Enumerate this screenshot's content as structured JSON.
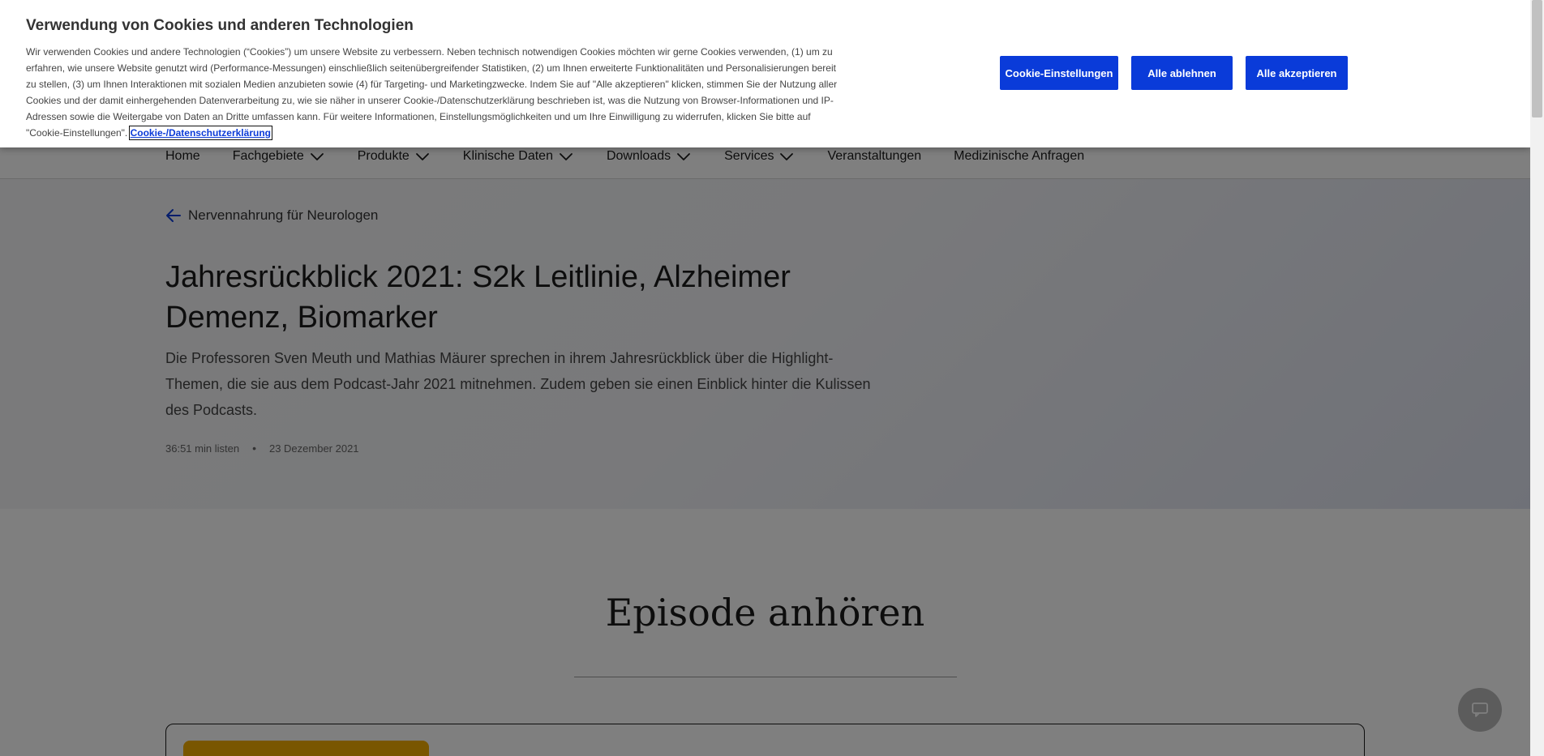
{
  "nav": {
    "items": [
      {
        "label": "Home",
        "has_dropdown": false
      },
      {
        "label": "Fachgebiete",
        "has_dropdown": true
      },
      {
        "label": "Produkte",
        "has_dropdown": true
      },
      {
        "label": "Klinische Daten",
        "has_dropdown": true
      },
      {
        "label": "Downloads",
        "has_dropdown": true
      },
      {
        "label": "Services",
        "has_dropdown": true
      },
      {
        "label": "Veranstaltungen",
        "has_dropdown": false
      },
      {
        "label": "Medizinische Anfragen",
        "has_dropdown": false
      }
    ]
  },
  "hero": {
    "back_label": "Nervennahrung für Neurologen",
    "title": "Jahresrückblick 2021: S2k Leitlinie, Alzheimer Demenz, Biomarker",
    "description": "Die Professoren Sven Meuth und Mathias Mäurer sprechen in ihrem Jahresrückblick über die Highlight-Themen, die sie aus dem Podcast-Jahr 2021 mitnehmen. Zudem geben sie einen Einblick hinter die Kulissen des Podcasts.",
    "duration": "36:51 min listen",
    "separator": "•",
    "date": "23 Dezember 2021"
  },
  "episode": {
    "heading": "Episode anhören"
  },
  "cookie_banner": {
    "title": "Verwendung von Cookies und anderen Technologien",
    "text": "Wir verwenden Cookies und andere Technologien (“Cookies”) um unsere Website zu verbessern. Neben technisch notwendigen Cookies möchten wir gerne Cookies verwenden, (1) um zu erfahren, wie unsere Website genutzt wird (Performance-Messungen) einschließlich seitenübergreifender Statistiken, (2) um Ihnen erweiterte Funktionalitäten und Personalisierungen bereit zu stellen, (3) um Ihnen Interaktionen mit sozialen Medien anzubieten sowie (4) für Targeting- und Marketingzwecke. Indem Sie auf \"Alle akzeptieren\" klicken, stimmen Sie der Nutzung aller Cookies und der damit einhergehenden Datenverarbeitung zu, wie sie näher in unserer Cookie-/Datenschutzerklärung beschrieben ist, was die Nutzung von Browser-Informationen und IP-Adressen sowie die Weitergabe von Daten an Dritte umfassen kann. Für weitere Informationen, Einstellungsmöglichkeiten und um Ihre Einwilligung zu widerrufen, klicken Sie bitte auf \"Cookie-Einstellungen\".",
    "link_label": "Cookie-/Datenschutzerklärung",
    "buttons": {
      "settings": "Cookie-Einstellungen",
      "reject": "Alle ablehnen",
      "accept": "Alle akzeptieren"
    }
  },
  "colors": {
    "button_blue": "#0a3bd9",
    "link_blue": "#0c3bd8",
    "overlay": "rgba(0,0,0,0.5)",
    "player_thumb": "#f2ad00"
  },
  "icons": {
    "back": "arrow-left-icon",
    "dropdown": "chevron-down-icon",
    "chat": "chat-bubble-icon"
  }
}
